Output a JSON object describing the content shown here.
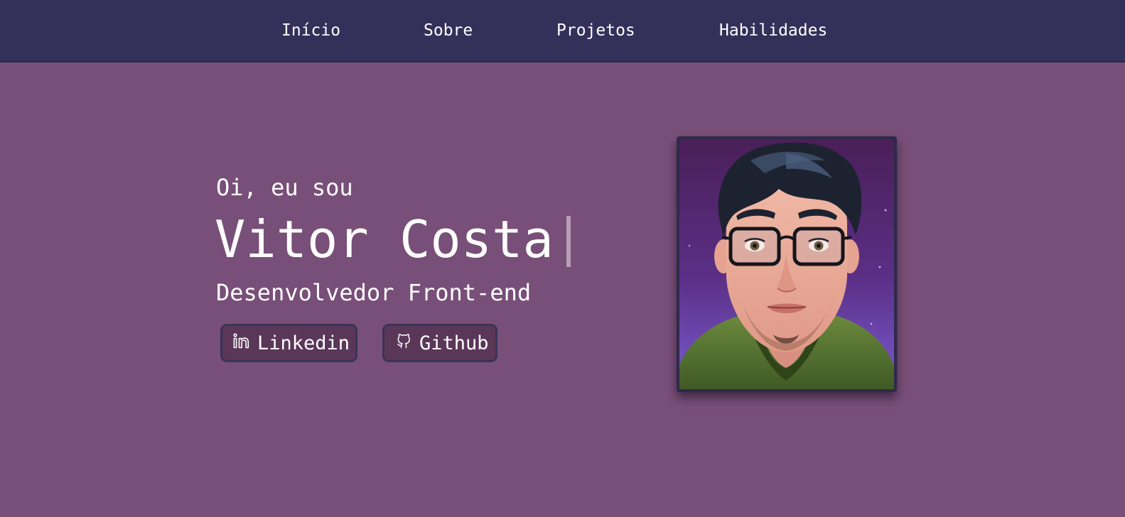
{
  "nav": {
    "items": [
      {
        "label": "Início"
      },
      {
        "label": "Sobre"
      },
      {
        "label": "Projetos"
      },
      {
        "label": "Habilidades"
      }
    ]
  },
  "hero": {
    "greeting": "Oi, eu sou",
    "name": "Vitor Costa",
    "role": "Desenvolvedor Front-end",
    "buttons": {
      "linkedin": {
        "label": "Linkedin",
        "icon": "linkedin-icon"
      },
      "github": {
        "label": "Github",
        "icon": "github-icon"
      }
    },
    "avatar": {
      "icon": "avatar-portrait"
    }
  },
  "colors": {
    "background": "#784f78",
    "navbar": "#33305a",
    "button_bg": "#5a3758",
    "button_border": "#393456",
    "caret": "#b99db8"
  }
}
